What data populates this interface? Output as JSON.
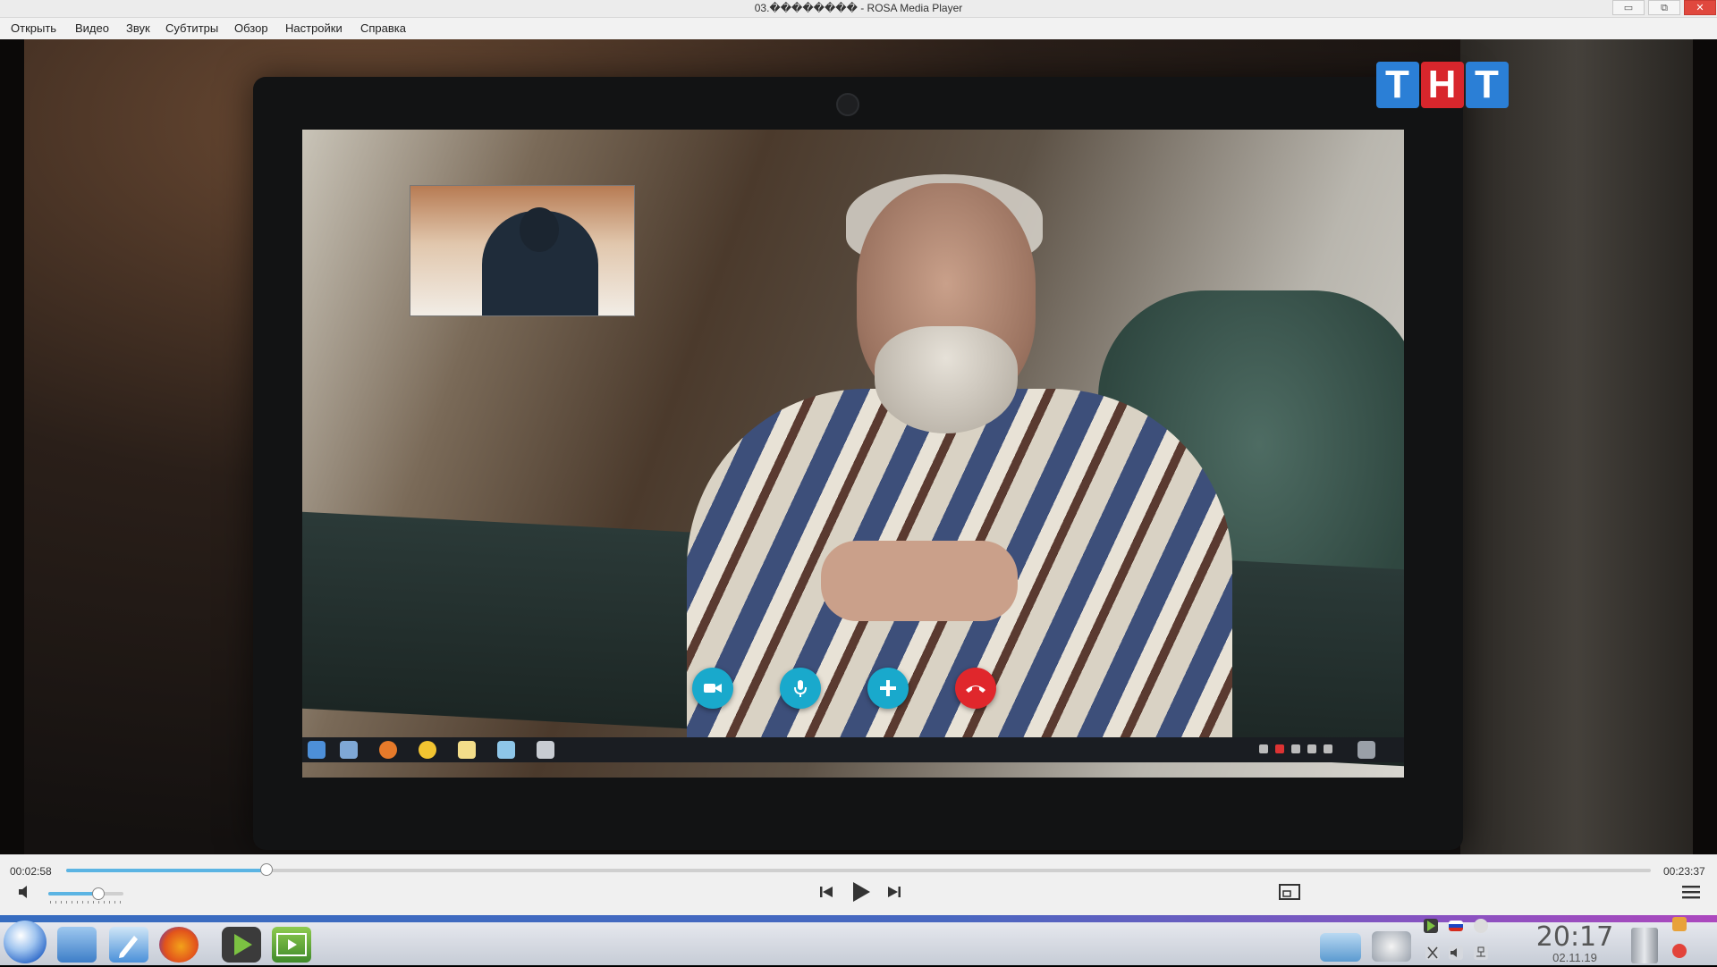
{
  "window": {
    "title": "03.�������� - ROSA Media Player",
    "minimize_label": "▭",
    "maximize_label": "⧉",
    "close_label": "✕"
  },
  "menu": [
    "Открыть",
    "Видео",
    "Звук",
    "Субтитры",
    "Обзор",
    "Настройки",
    "Справка"
  ],
  "player": {
    "time_elapsed": "00:02:58",
    "time_total": "00:23:37",
    "progress_fraction": 0.126,
    "volume_fraction": 0.65,
    "icons": [
      "volume-icon",
      "previous-icon",
      "play-icon",
      "next-icon",
      "aspect-ratio-icon",
      "menu-icon"
    ]
  },
  "video": {
    "channel_logo": "ТНТ",
    "logo_colors": [
      "#2b7fd6",
      "#d8262c",
      "#2b7fd6"
    ],
    "call_buttons": [
      "video-camera-icon",
      "microphone-icon",
      "add-icon",
      "hang-up-icon"
    ],
    "call_button_color": "#19a9cc",
    "hangup_color": "#e0272c"
  },
  "taskbar": {
    "time": "20:17",
    "date": "02.11.19",
    "apps": [
      "start-menu-icon",
      "file-manager-icon",
      "text-editor-icon",
      "firefox-icon",
      "media-player-icon",
      "video-editor-icon"
    ],
    "tray": [
      "screenshot-icon",
      "settings-icon",
      "media-player-tray-icon",
      "russian-flag-icon",
      "usb-icon",
      "scissors-icon",
      "volume-icon",
      "network-icon",
      "trash-icon",
      "lock-icon",
      "power-icon"
    ]
  }
}
